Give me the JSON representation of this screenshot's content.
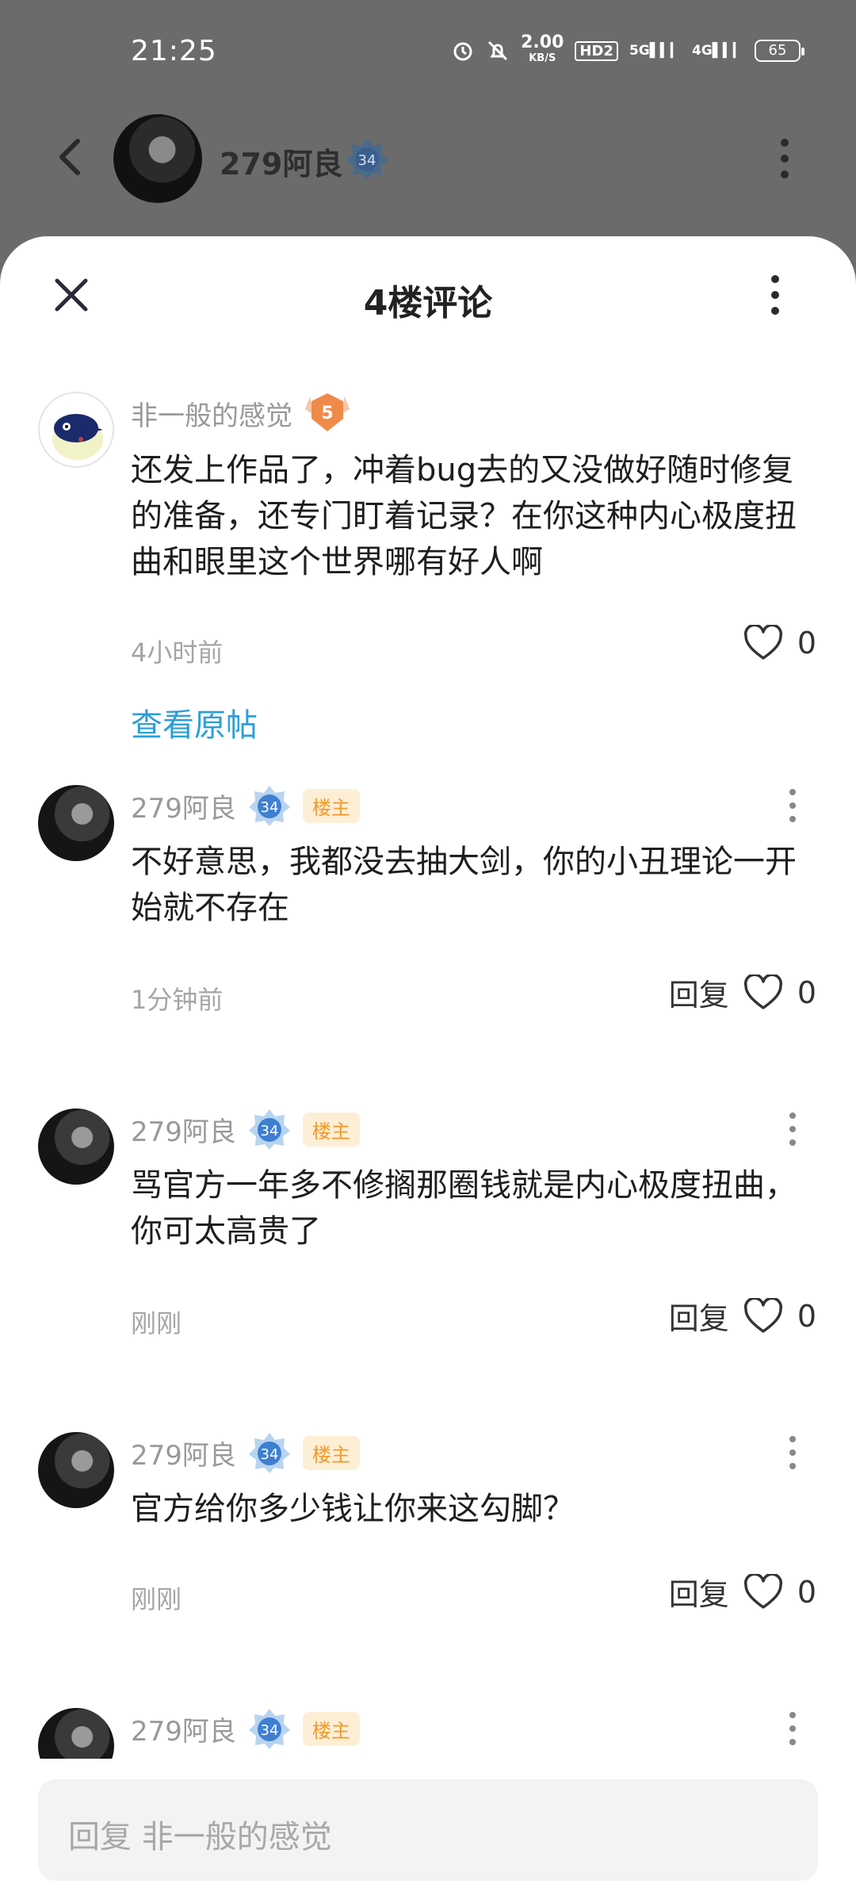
{
  "status": {
    "time": "21:25",
    "net_speed": "2.00",
    "net_unit": "KB/S",
    "hd": "HD2",
    "sig1": "5G",
    "sig2": "4G",
    "battery": "65"
  },
  "header": {
    "name": "279阿良",
    "level": "34"
  },
  "sheet": {
    "title": "4楼评论",
    "reply_placeholder": "回复 非一般的感觉"
  },
  "comments": [
    {
      "user": "非一般的感觉",
      "level": "5",
      "text": "还发上作品了，冲着bug去的又没做好随时修复的准备，还专门盯着记录？在你这种内心极度扭曲和眼里这个世界哪有好人啊",
      "time": "4小时前",
      "likes": "0",
      "link": "查看原帖"
    },
    {
      "user": "279阿良",
      "level": "34",
      "badge": "楼主",
      "text": "不好意思，我都没去抽大剑，你的小丑理论一开始就不存在",
      "time": "1分钟前",
      "reply": "回复",
      "likes": "0"
    },
    {
      "user": "279阿良",
      "level": "34",
      "badge": "楼主",
      "text": "骂官方一年多不修搁那圈钱就是内心极度扭曲，你可太高贵了",
      "time": "刚刚",
      "reply": "回复",
      "likes": "0"
    },
    {
      "user": "279阿良",
      "level": "34",
      "badge": "楼主",
      "text": "官方给你多少钱让你来这勾脚？",
      "time": "刚刚",
      "reply": "回复",
      "likes": "0"
    },
    {
      "user": "279阿良",
      "level": "34",
      "badge": "楼主"
    }
  ]
}
